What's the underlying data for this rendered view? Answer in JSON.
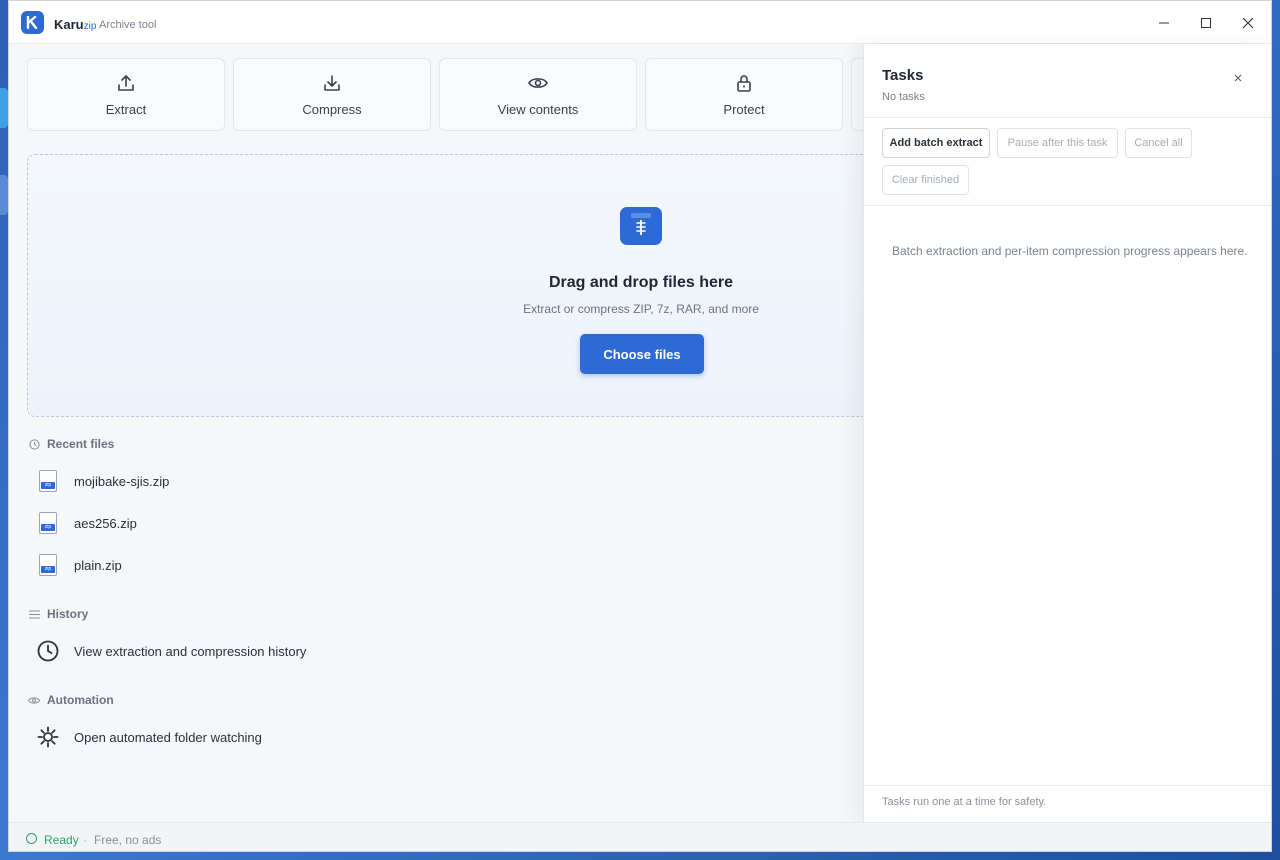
{
  "window": {
    "app_name": "Karu",
    "app_name_suffix": "zip",
    "tagline": "Archive tool",
    "logo_letter": "K"
  },
  "actions": [
    {
      "label": "Extract",
      "icon": "upload-icon"
    },
    {
      "label": "Compress",
      "icon": "download-icon"
    },
    {
      "label": "View contents",
      "icon": "eye-icon"
    },
    {
      "label": "Protect",
      "icon": "lock-icon"
    }
  ],
  "dropzone": {
    "title": "Drag and drop files here",
    "subtitle": "Extract or compress ZIP, 7z, RAR, and more",
    "button": "Choose files"
  },
  "recent": {
    "heading": "Recent files",
    "file_tag": "zip",
    "items": [
      "mojibake-sjis.zip",
      "aes256.zip",
      "plain.zip"
    ]
  },
  "history": {
    "heading": "History",
    "item": "View extraction and compression history"
  },
  "automation": {
    "heading": "Automation",
    "item": "Open automated folder watching"
  },
  "status": {
    "ready": "Ready",
    "separator": "·",
    "free": "Free, no ads"
  },
  "tasks": {
    "title": "Tasks",
    "subtitle": "No tasks",
    "add_batch": "Add batch extract",
    "pause_after": "Pause after this task",
    "cancel_all": "Cancel all",
    "clear_finished": "Clear finished",
    "empty_message": "Batch extraction and per-item compression progress appears here.",
    "footer": "Tasks run one at a time for safety."
  },
  "colors": {
    "accent": "#2d6ad6",
    "ready": "#2aa56b"
  }
}
